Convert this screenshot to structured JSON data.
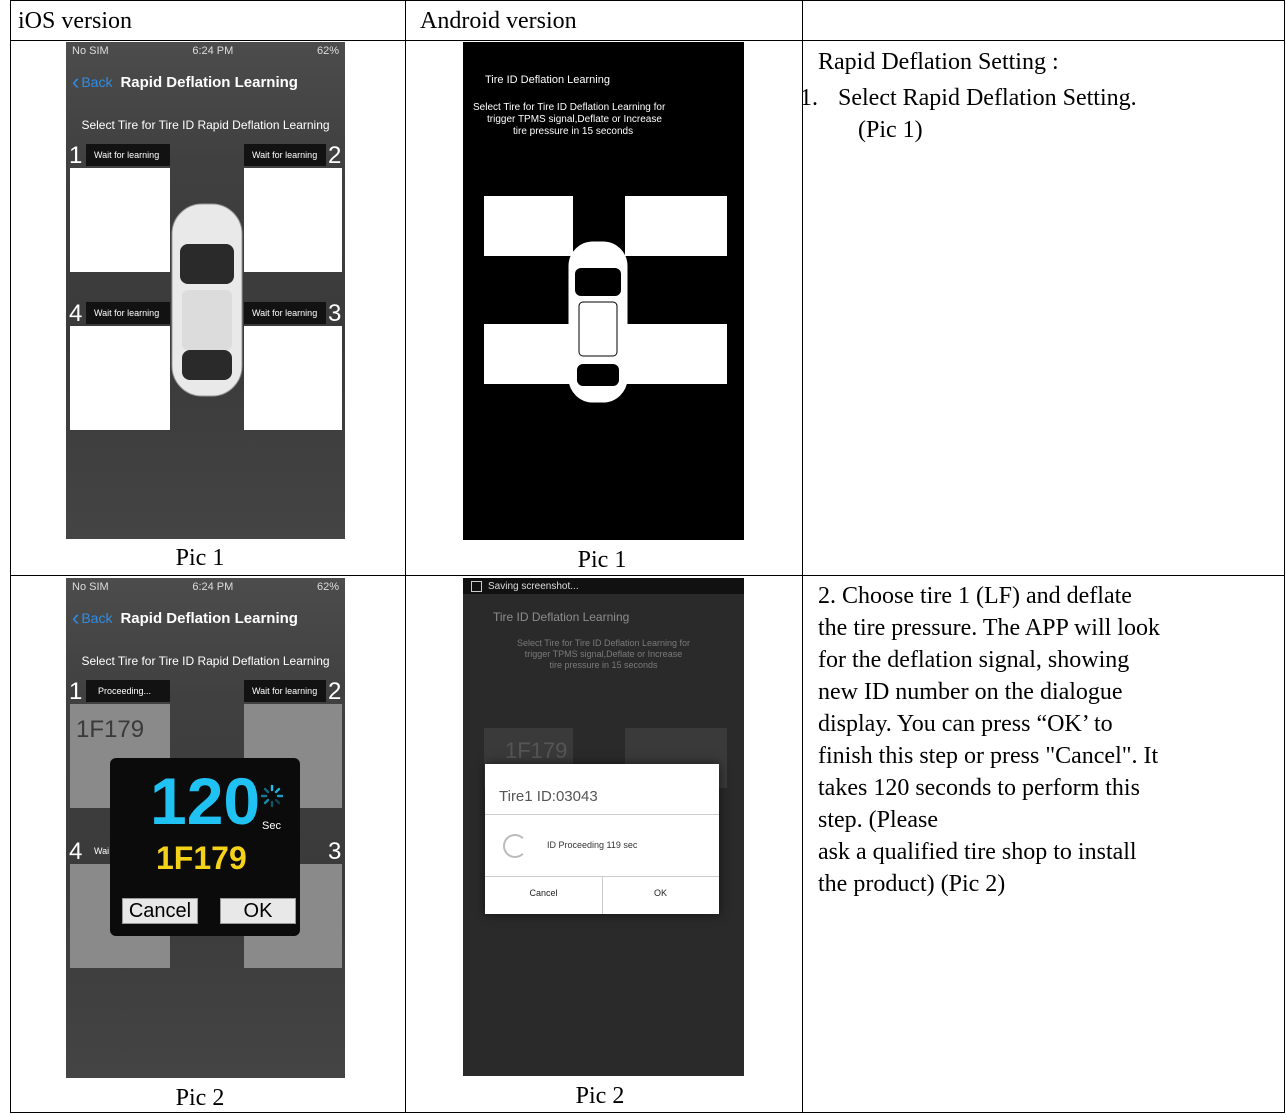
{
  "headers": {
    "col1": "iOS version",
    "col2": "Android version",
    "col3": ""
  },
  "captions": {
    "r1c1": "Pic 1",
    "r1c2": "Pic 1",
    "r2c1": "Pic 2",
    "r2c2": "Pic 2"
  },
  "step1": {
    "title": "Rapid Deflation Setting :",
    "item_number": "1.",
    "item_text": "Select Rapid Deflation Setting.",
    "item_ref": "(Pic 1)"
  },
  "step2": {
    "lines": [
      "2. Choose tire 1 (LF) and deflate",
      "the tire pressure. The APP will look",
      "for the deflation signal, showing",
      "new ID number on the dialogue",
      "display. You can press “OK’ to",
      "finish this step or press \"Cancel\". It",
      "takes 120 seconds to perform this",
      "step. (Please",
      "ask a qualified tire shop to install",
      "the product) (Pic 2)"
    ]
  },
  "ios1": {
    "status_carrier": "No SIM",
    "status_time": "6:24 PM",
    "status_battery": "62%",
    "back_label": "Back",
    "nav_title": "Rapid Deflation Learning",
    "instruction": "Select Tire for Tire ID Rapid Deflation Learning",
    "tiles": [
      {
        "num": "1",
        "status": "Wait for learning"
      },
      {
        "num": "2",
        "status": "Wait for learning"
      },
      {
        "num": "4",
        "status": "Wait for learning"
      },
      {
        "num": "3",
        "status": "Wait for learning"
      }
    ]
  },
  "ios2": {
    "status_carrier": "No SIM",
    "status_time": "6:24 PM",
    "status_battery": "62%",
    "back_label": "Back",
    "nav_title": "Rapid Deflation Learning",
    "instruction": "Select Tire for Tire ID Rapid Deflation Learning",
    "tile1_status": "Proceeding...",
    "tile2_status": "Wait for learning",
    "tile1_num": "1",
    "tile2_num": "2",
    "tile4_num": "4",
    "tile3_num": "3",
    "tile4_status": "Wai",
    "tile1_id": "1F179",
    "popup_count": "120",
    "popup_unit": "Sec",
    "popup_id": "1F179",
    "cancel_label": "Cancel",
    "ok_label": "OK"
  },
  "android1": {
    "title": "Tire ID Deflation Learning",
    "instruction_lines": [
      "Select Tire for Tire ID Deflation Learning for",
      "trigger TPMS signal,Deflate or Increase",
      "tire pressure in 15 seconds"
    ]
  },
  "android2": {
    "status_text": "Saving screenshot...",
    "title": "Tire ID Deflation Learning",
    "instruction_lines": [
      "Select Tire for Tire ID Deflation Learning for",
      "trigger TPMS signal,Deflate or Increase",
      "tire pressure in 15 seconds"
    ],
    "bg_id": "1F179",
    "dialog_title": "Tire1 ID:03043",
    "dialog_message": "ID Proceeding 119 sec",
    "cancel_label": "Cancel",
    "ok_label": "OK"
  },
  "colors": {
    "ios_accent": "#2f8de4",
    "countdown": "#1fc2f2",
    "popup_id": "#f5d21a"
  }
}
